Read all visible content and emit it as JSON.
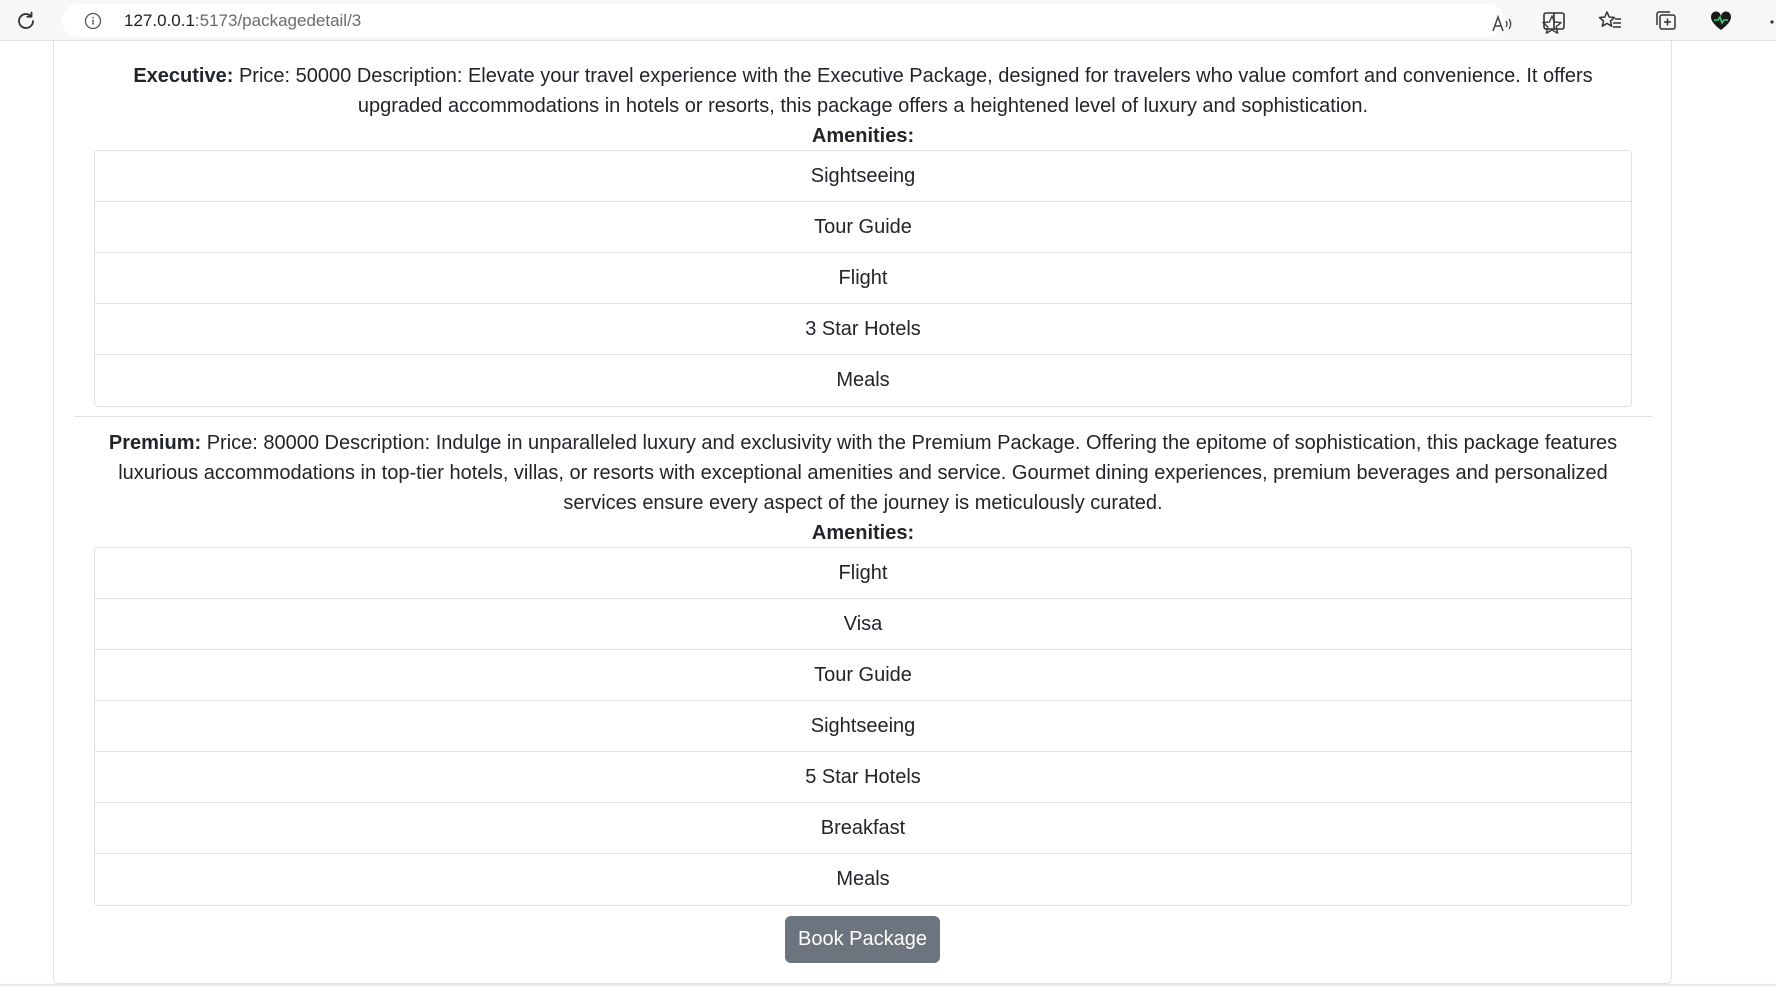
{
  "browser": {
    "url_host": "127.0.0.1",
    "url_path": ":5173/packagedetail/3"
  },
  "packages": [
    {
      "name": "Executive:",
      "summary": " Price: 50000 Description: Elevate your travel experience with the Executive Package, designed for travelers who value comfort and convenience. It offers upgraded accommodations in hotels or resorts, this package offers a heightened level of luxury and sophistication.",
      "amenities_title": "Amenities:",
      "amenities": [
        "Sightseeing",
        "Tour Guide",
        "Flight",
        "3 Star Hotels",
        "Meals"
      ]
    },
    {
      "name": "Premium:",
      "summary": " Price: 80000 Description: Indulge in unparalleled luxury and exclusivity with the Premium Package. Offering the epitome of sophistication, this package features luxurious accommodations in top-tier hotels, villas, or resorts with exceptional amenities and service. Gourmet dining experiences, premium beverages and personalized services ensure every aspect of the journey is meticulously curated.",
      "amenities_title": "Amenities:",
      "amenities": [
        "Flight",
        "Visa",
        "Tour Guide",
        "Sightseeing",
        "5 Star Hotels",
        "Breakfast",
        "Meals"
      ]
    }
  ],
  "actions": {
    "book_label": "Book Package"
  },
  "colors": {
    "button_bg": "#6c757d",
    "border": "#dee2e6",
    "text": "#212529"
  }
}
